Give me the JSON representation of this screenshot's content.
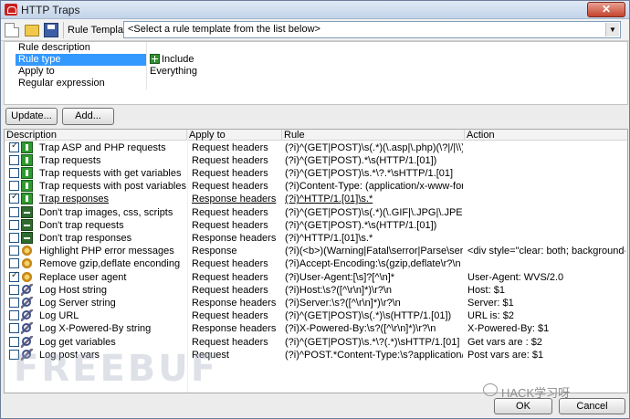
{
  "window": {
    "title": "HTTP Traps",
    "close": "✕"
  },
  "toolbar": {
    "template_label": "Rule Template:",
    "template_value": "<Select a rule template from the list below>"
  },
  "props": [
    {
      "name": "Rule description",
      "value": ""
    },
    {
      "name": "Rule type",
      "value": "Include"
    },
    {
      "name": "Apply to",
      "value": "Everything"
    },
    {
      "name": "Regular expression",
      "value": ""
    }
  ],
  "buttons": {
    "update": "Update...",
    "add": "Add...",
    "ok": "OK",
    "cancel": "Cancel"
  },
  "grid": {
    "headers": [
      "Description",
      "Apply to",
      "Rule",
      "Action"
    ],
    "rows": [
      {
        "checked": true,
        "icon": "include",
        "name": "Trap ASP and PHP requests",
        "apply": "Request headers",
        "rule": "(?i)^(GET|POST)\\s(.*)(\\.asp|\\.php)(\\?|/|\\\\).*)?\\s(...",
        "action": ""
      },
      {
        "checked": false,
        "icon": "include",
        "name": "Trap requests",
        "apply": "Request headers",
        "rule": "(?i)^(GET|POST).*\\s(HTTP/1.[01])",
        "action": ""
      },
      {
        "checked": false,
        "icon": "include",
        "name": "Trap requests with get variables",
        "apply": "Request headers",
        "rule": "(?i)^(GET|POST)\\s.*\\?.*\\sHTTP/1.[01]",
        "action": ""
      },
      {
        "checked": false,
        "icon": "include",
        "name": "Trap requests with post variables",
        "apply": "Request headers",
        "rule": "(?i)Content-Type: (application/x-www-form-urlen...",
        "action": ""
      },
      {
        "checked": true,
        "icon": "include",
        "name": "Trap responses",
        "apply": "Response headers",
        "rule": "(?i)^HTTP/1.[01]\\s.*",
        "action": ""
      },
      {
        "checked": false,
        "icon": "exclude",
        "name": "Don't trap images, css, scripts",
        "apply": "Request headers",
        "rule": "(?i)^(GET|POST)\\s(.*)(\\.GIF|\\.JPG|\\.JPEG|\\.PNG|...",
        "action": ""
      },
      {
        "checked": false,
        "icon": "exclude",
        "name": "Don't trap requests",
        "apply": "Request headers",
        "rule": "(?i)^(GET|POST).*\\s(HTTP/1.[01])",
        "action": ""
      },
      {
        "checked": false,
        "icon": "exclude",
        "name": "Don't trap responses",
        "apply": "Response headers",
        "rule": "(?i)^HTTP/1.[01]\\s.*",
        "action": ""
      },
      {
        "checked": false,
        "icon": "modify",
        "name": "Highlight PHP error messages",
        "apply": "Response",
        "rule": "(?i)(<b>)(Warning|Fatal\\serror|Parse\\serror)(</b>:...",
        "action": "<div style=\"clear: both; background-c..."
      },
      {
        "checked": false,
        "icon": "modify",
        "name": "Remove gzip,deflate enconding",
        "apply": "Request headers",
        "rule": "(?i)Accept-Encoding:\\s(gzip,deflate\\r?\\n",
        "action": ""
      },
      {
        "checked": true,
        "icon": "modify",
        "name": "Replace user agent",
        "apply": "Request headers",
        "rule": "(?i)User-Agent:[\\s]?[^\\n]*",
        "action": "User-Agent: WVS/2.0"
      },
      {
        "checked": false,
        "icon": "log",
        "name": "Log Host string",
        "apply": "Request headers",
        "rule": "(?i)Host:\\s?([^\\r\\n]*)\\r?\\n",
        "action": "Host: $1"
      },
      {
        "checked": false,
        "icon": "log",
        "name": "Log Server string",
        "apply": "Response headers",
        "rule": "(?i)Server:\\s?([^\\r\\n]*)\\r?\\n",
        "action": "Server: $1"
      },
      {
        "checked": false,
        "icon": "log",
        "name": "Log URL",
        "apply": "Request headers",
        "rule": "(?i)^(GET|POST)\\s(.*)\\s(HTTP/1.[01])",
        "action": "URL is: $2"
      },
      {
        "checked": false,
        "icon": "log",
        "name": "Log X-Powered-By string",
        "apply": "Response headers",
        "rule": "(?i)X-Powered-By:\\s?([^\\r\\n]*)\\r?\\n",
        "action": "X-Powered-By: $1"
      },
      {
        "checked": false,
        "icon": "log",
        "name": "Log get variables",
        "apply": "Request headers",
        "rule": "(?i)^(GET|POST)\\s.*\\?(.*)\\sHTTP/1.[01]",
        "action": "Get vars are : $2"
      },
      {
        "checked": false,
        "icon": "log",
        "name": "Log post vars",
        "apply": "Request",
        "rule": "(?i)^POST.*Content-Type:\\s?application/x-www-...",
        "action": "Post vars are: $1"
      }
    ]
  },
  "watermark": {
    "left": "FREEBUF",
    "right": "HACK学习呀"
  }
}
